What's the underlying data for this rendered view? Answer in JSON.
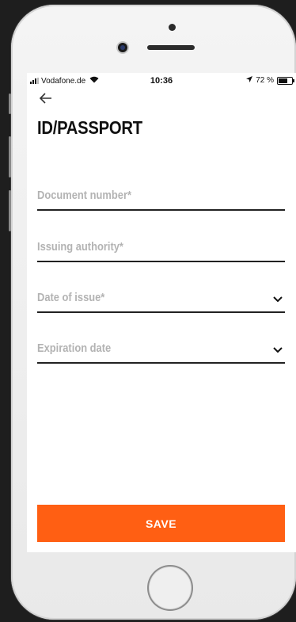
{
  "status_bar": {
    "carrier": "Vodafone.de",
    "time": "10:36",
    "battery": "72 %"
  },
  "header": {
    "back_icon": "arrow-left-icon",
    "title": "ID/PASSPORT"
  },
  "form": {
    "document_number": {
      "placeholder": "Document number*"
    },
    "issuing_authority": {
      "placeholder": "Issuing authority*"
    },
    "date_of_issue": {
      "placeholder": "Date of issue*",
      "icon": "chevron-down-icon"
    },
    "expiration_date": {
      "placeholder": "Expiration date",
      "icon": "chevron-down-icon"
    }
  },
  "actions": {
    "save_label": "SAVE"
  },
  "colors": {
    "accent": "#ff5f13",
    "placeholder": "#b3b3b3",
    "text": "#111111"
  }
}
